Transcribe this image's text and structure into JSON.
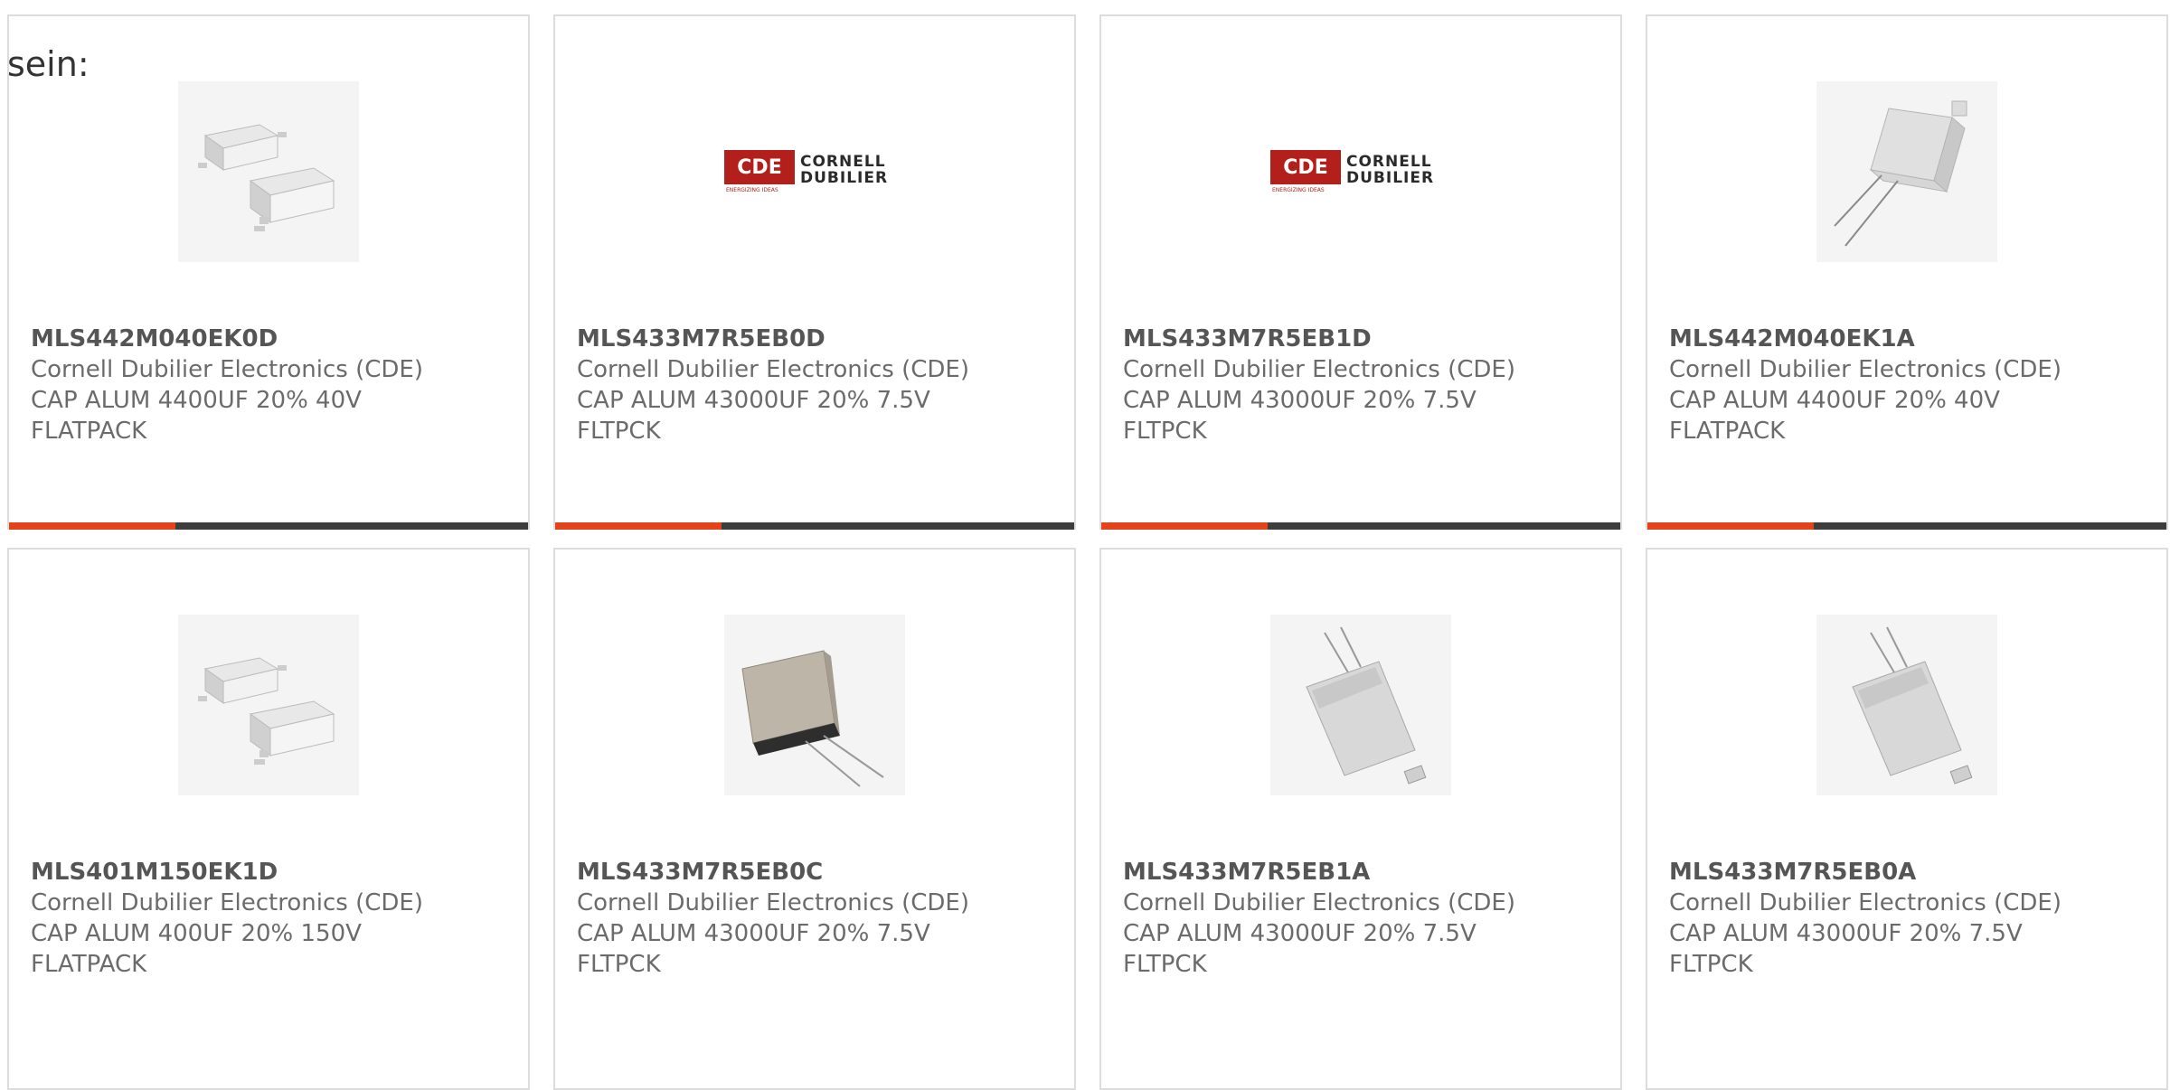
{
  "intro_text": "sein:",
  "products": [
    {
      "part": "MLS442M040EK0D",
      "maker": "Cornell Dubilier Electronics (CDE)",
      "desc1": "CAP ALUM 4400UF 20% 40V",
      "desc2": "FLATPACK",
      "image": "flatpack-pair-icon"
    },
    {
      "part": "MLS433M7R5EB0D",
      "maker": "Cornell Dubilier Electronics (CDE)",
      "desc1": "CAP ALUM 43000UF 20% 7.5V",
      "desc2": "FLTPCK",
      "image": "cde-logo"
    },
    {
      "part": "MLS433M7R5EB1D",
      "maker": "Cornell Dubilier Electronics (CDE)",
      "desc1": "CAP ALUM 43000UF 20% 7.5V",
      "desc2": "FLTPCK",
      "image": "cde-logo"
    },
    {
      "part": "MLS442M040EK1A",
      "maker": "Cornell Dubilier Electronics (CDE)",
      "desc1": "CAP ALUM 4400UF 20% 40V",
      "desc2": "FLATPACK",
      "image": "flatpack-leaded-icon"
    },
    {
      "part": "MLS401M150EK1D",
      "maker": "Cornell Dubilier Electronics (CDE)",
      "desc1": "CAP ALUM 400UF 20% 150V",
      "desc2": "FLATPACK",
      "image": "flatpack-pair-icon"
    },
    {
      "part": "MLS433M7R5EB0C",
      "maker": "Cornell Dubilier Electronics (CDE)",
      "desc1": "CAP ALUM 43000UF 20% 7.5V",
      "desc2": "FLTPCK",
      "image": "flatpack-dark-icon"
    },
    {
      "part": "MLS433M7R5EB1A",
      "maker": "Cornell Dubilier Electronics (CDE)",
      "desc1": "CAP ALUM 43000UF 20% 7.5V",
      "desc2": "FLTPCK",
      "image": "flatpack-silver-icon"
    },
    {
      "part": "MLS433M7R5EB0A",
      "maker": "Cornell Dubilier Electronics (CDE)",
      "desc1": "CAP ALUM 43000UF 20% 7.5V",
      "desc2": "FLTPCK",
      "image": "flatpack-silver-icon"
    }
  ],
  "logo": {
    "abbr": "CDE",
    "line1": "CORNELL",
    "line2": "DUBILIER",
    "tagline": "ENERGIZING IDEAS"
  },
  "colors": {
    "accent": "#e3421a",
    "bar": "#3d3d3d",
    "logo_red": "#b3201c",
    "border": "#dcdcdc"
  }
}
